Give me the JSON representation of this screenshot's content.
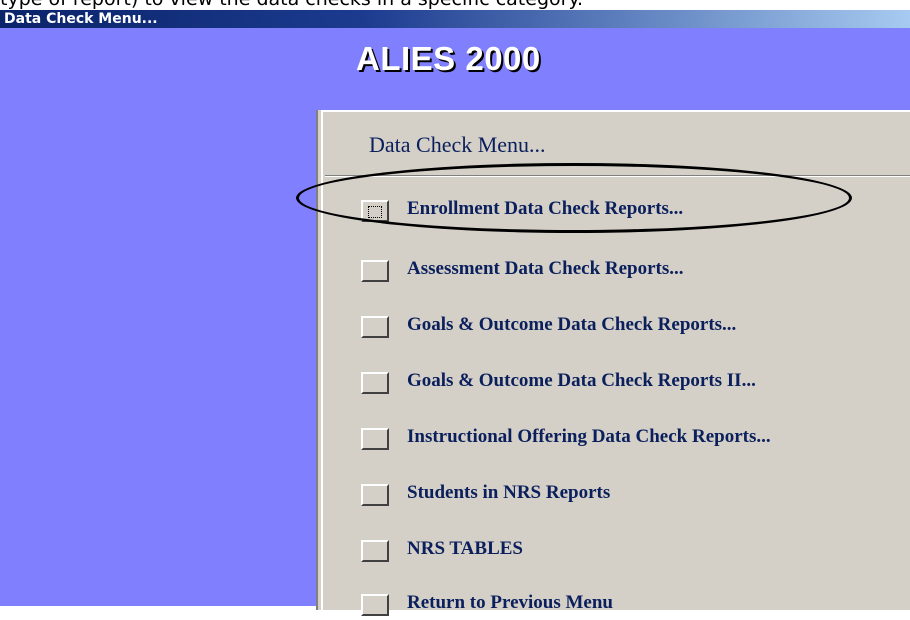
{
  "document": {
    "caption": "type of report) to view the data checks in a specific category."
  },
  "window": {
    "title": "Data Check Menu..."
  },
  "app": {
    "title": "ALIES 2000"
  },
  "menu": {
    "heading": "Data Check Menu...",
    "items": [
      {
        "label": "Enrollment Data Check Reports..."
      },
      {
        "label": "Assessment Data Check Reports..."
      },
      {
        "label": "Goals & Outcome Data Check Reports..."
      },
      {
        "label": "Goals & Outcome Data Check Reports II..."
      },
      {
        "label": "Instructional Offering Data Check Reports..."
      },
      {
        "label": "Students in NRS Reports"
      },
      {
        "label": "NRS TABLES"
      },
      {
        "label": "Return to Previous Menu"
      }
    ]
  },
  "colors": {
    "workspace": "#8080ff",
    "panel": "#d4d0c8",
    "text": "#0a1f5c"
  }
}
